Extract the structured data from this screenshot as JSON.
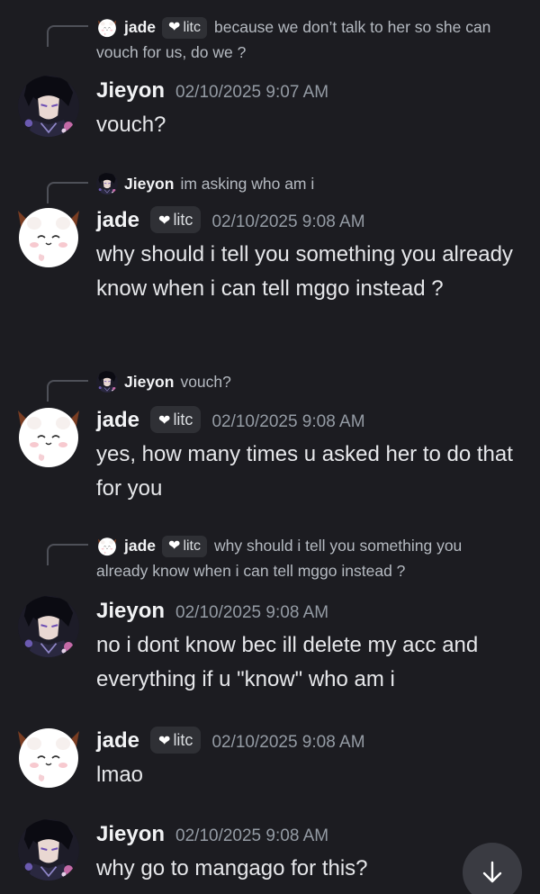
{
  "users": {
    "jade": {
      "name": "jade",
      "badge": "litc"
    },
    "jieyon": {
      "name": "Jieyon"
    }
  },
  "messages": [
    {
      "reply": {
        "user": "jade",
        "badge": "litc",
        "text": "because we don’t talk to her so she can vouch for us, do we ?"
      },
      "user": "Jieyon",
      "timestamp": "02/10/2025 9:07 AM",
      "text": "vouch?"
    },
    {
      "reply": {
        "user": "Jieyon",
        "text": "im asking who am i"
      },
      "user": "jade",
      "badge": "litc",
      "timestamp": "02/10/2025 9:08 AM",
      "text": "why should i tell you something you already know when i can tell mggo instead ?"
    },
    {
      "reply": {
        "user": "Jieyon",
        "text": "vouch?"
      },
      "user": "jade",
      "badge": "litc",
      "timestamp": "02/10/2025 9:08 AM",
      "text": "yes, how many times u asked her to do that for you"
    },
    {
      "reply": {
        "user": "jade",
        "badge": "litc",
        "text": "why should i tell you something you already know when i can tell mggo instead ?"
      },
      "user": "Jieyon",
      "timestamp": "02/10/2025 9:08 AM",
      "text": "no i dont know bec ill delete my acc and everything if u \"know\" who am i"
    },
    {
      "user": "jade",
      "badge": "litc",
      "timestamp": "02/10/2025 9:08 AM",
      "text": "lmao"
    },
    {
      "user": "Jieyon",
      "timestamp": "02/10/2025 9:08 AM",
      "text": "why go to mangago for this?"
    }
  ],
  "scroll_button": {
    "icon": "arrow-down-icon"
  },
  "colors": {
    "background": "#1c1c21",
    "badge_bg": "#2f3035",
    "timestamp": "#949ba4"
  }
}
